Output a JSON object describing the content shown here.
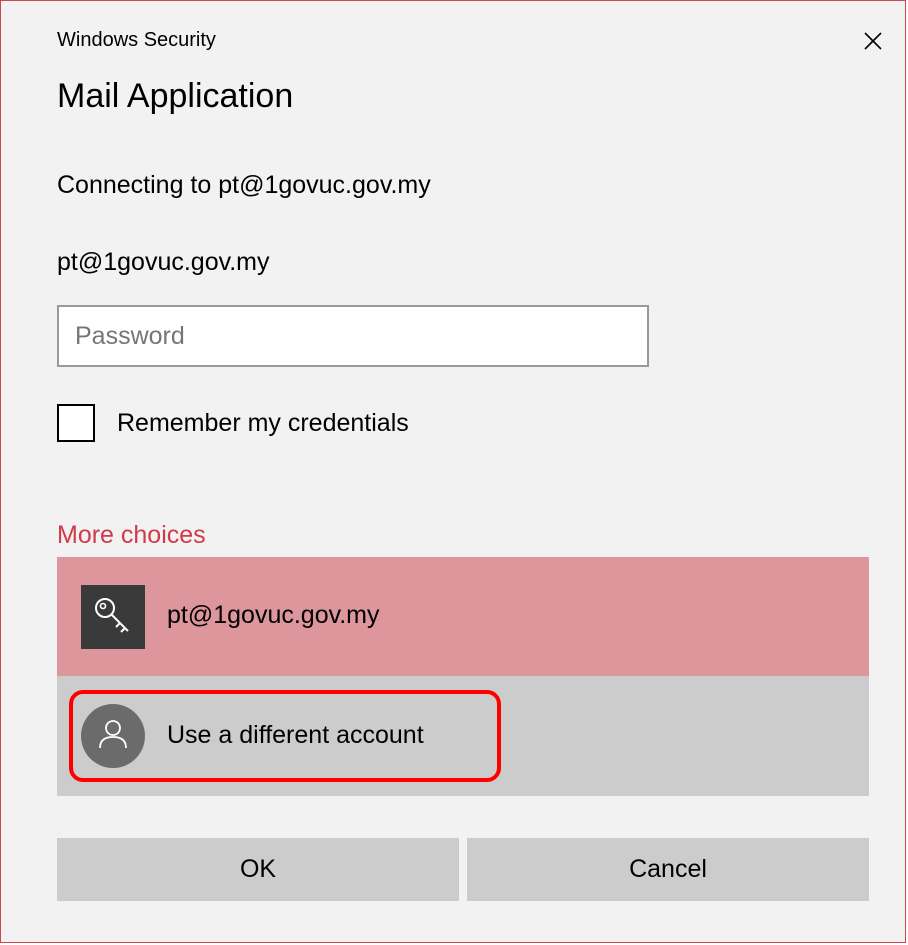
{
  "window": {
    "title": "Windows Security",
    "close_icon": "close-icon"
  },
  "dialog": {
    "heading": "Mail Application",
    "connecting_text": "Connecting to pt@1govuc.gov.my",
    "username": "pt@1govuc.gov.my",
    "password": {
      "value": "",
      "placeholder": "Password"
    },
    "remember": {
      "label": "Remember my credentials",
      "checked": false
    },
    "more_choices_label": "More choices",
    "accounts": [
      {
        "label": "pt@1govuc.gov.my",
        "icon": "key-icon",
        "selected": true
      },
      {
        "label": "Use a different account",
        "icon": "person-icon",
        "selected": false
      }
    ],
    "buttons": {
      "ok": "OK",
      "cancel": "Cancel"
    }
  },
  "colors": {
    "accent": "#d03a49",
    "selected_row": "#dc969c",
    "other_row": "#cccccc",
    "button_bg": "#cccccc",
    "annotation": "#ff0000"
  }
}
